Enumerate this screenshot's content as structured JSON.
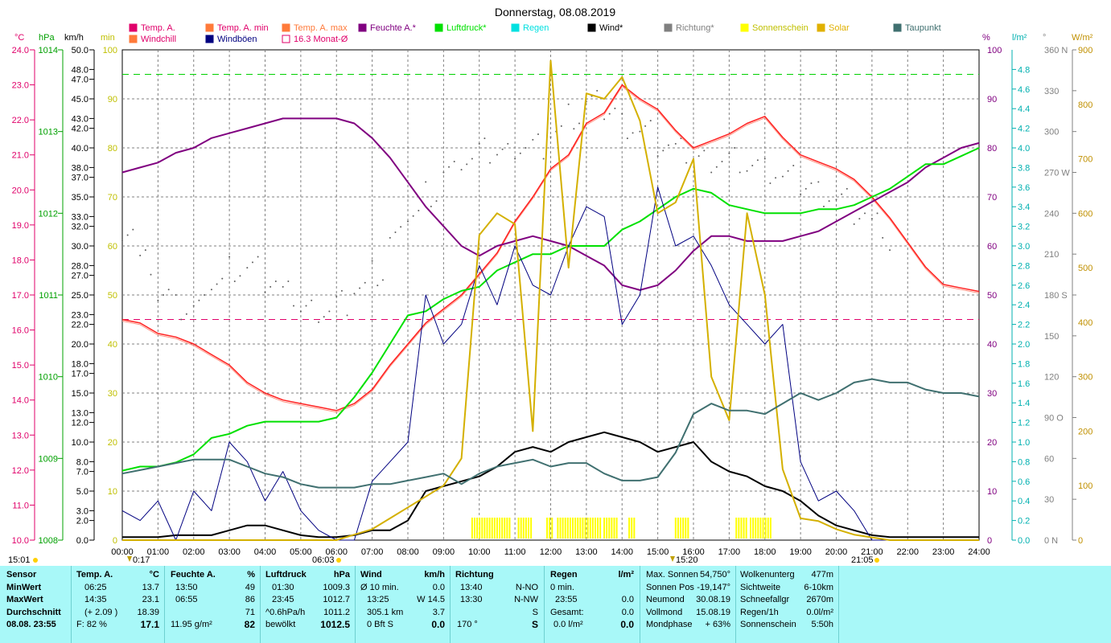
{
  "title": "Donnerstag, 08.08.2019",
  "legend": [
    {
      "label": "Temp. A.",
      "color": "#e0006a",
      "box": "fill"
    },
    {
      "label": "Temp. A. min",
      "color": "#ff7a3a",
      "box": "fill"
    },
    {
      "label": "Temp. A. max",
      "color": "#ff7a3a",
      "box": "fill"
    },
    {
      "label": "Feuchte A.*",
      "color": "#800080",
      "box": "fill"
    },
    {
      "label": "Luftdruck*",
      "color": "#00e000",
      "box": "fill"
    },
    {
      "label": "Regen",
      "color": "#00e0e0",
      "box": "fill"
    },
    {
      "label": "Wind*",
      "color": "#000000",
      "box": "fill"
    },
    {
      "label": "Richtung*",
      "color": "#808080",
      "box": "fill"
    },
    {
      "label": "Sonnenschein",
      "color": "#ffff00",
      "box": "fill"
    },
    {
      "label": "Solar",
      "color": "#e0b000",
      "box": "fill"
    },
    {
      "label": "Taupunkt",
      "color": "#407070",
      "box": "fill"
    },
    {
      "label": "Windchill",
      "color": "#ff7a3a",
      "box": "fill"
    },
    {
      "label": "Windböen",
      "color": "#000080",
      "box": "fill"
    },
    {
      "label": "16.3 Monat-Ø",
      "color": "#e0006a",
      "box": "outline"
    }
  ],
  "units": {
    "temp": "°C",
    "press": "hPa",
    "wind": "km/h",
    "sunmin": "min",
    "hum": "%",
    "rain": "l/m²",
    "dir": "°",
    "solar": "W/m²"
  },
  "axes": {
    "temp": [
      "24.0",
      "23.0",
      "22.0",
      "21.0",
      "20.0",
      "19.0",
      "18.0",
      "17.0",
      "16.0",
      "15.0",
      "14.0",
      "13.0",
      "12.0",
      "11.0",
      "10.0"
    ],
    "press": [
      "1014",
      "1013",
      "1012",
      "1011",
      "1010",
      "1009",
      "1008"
    ],
    "wind": [
      "50.0",
      "48.0",
      "47.0",
      "45.0",
      "43.0",
      "42.0",
      "40.0",
      "38.0",
      "37.0",
      "35.0",
      "33.0",
      "32.0",
      "30.0",
      "28.0",
      "27.0",
      "25.0",
      "23.0",
      "22.0",
      "20.0",
      "18.0",
      "17.0",
      "15.0",
      "13.0",
      "12.0",
      "10.0",
      "8.0",
      "7.0",
      "5.0",
      "3.0",
      "2.0",
      "0.0"
    ],
    "sunmin": [
      "100",
      "90",
      "80",
      "70",
      "60",
      "50",
      "40",
      "30",
      "20",
      "10",
      "0"
    ],
    "hum": [
      "100",
      "90",
      "80",
      "70",
      "60",
      "50",
      "40",
      "30",
      "20",
      "10",
      "0"
    ],
    "rain": [
      "4.8",
      "4.6",
      "4.4",
      "4.2",
      "4.0",
      "3.8",
      "3.6",
      "3.4",
      "3.2",
      "3.0",
      "2.8",
      "2.6",
      "2.4",
      "2.2",
      "2.0",
      "1.8",
      "1.6",
      "1.4",
      "1.2",
      "1.0",
      "0.8",
      "0.6",
      "0.4",
      "0.2",
      "0.0"
    ],
    "dir": [
      "360 N",
      "330",
      "300",
      "270 W",
      "240",
      "210",
      "180 S",
      "150",
      "120",
      "90 O",
      "60",
      "30",
      "0 N"
    ],
    "solar": [
      "900",
      "800",
      "700",
      "600",
      "500",
      "400",
      "300",
      "200",
      "100",
      "0"
    ],
    "time": [
      "00:00",
      "01:00",
      "02:00",
      "03:00",
      "04:00",
      "05:00",
      "06:00",
      "07:00",
      "08:00",
      "09:00",
      "10:00",
      "11:00",
      "12:00",
      "13:00",
      "14:00",
      "15:00",
      "16:00",
      "17:00",
      "18:00",
      "19:00",
      "20:00",
      "21:00",
      "22:00",
      "23:00",
      "24:00"
    ]
  },
  "markers": {
    "sunrise": "06:03",
    "sunset": "21:05",
    "moonrise": "15:01",
    "moonset": "0:17",
    "culmination": "15:20"
  },
  "chart_data": {
    "type": "line",
    "title": "Donnerstag, 08.08.2019",
    "x_hours": [
      0,
      0.5,
      1,
      1.5,
      2,
      2.5,
      3,
      3.5,
      4,
      4.5,
      5,
      5.5,
      6,
      6.5,
      7,
      7.5,
      8,
      8.5,
      9,
      9.5,
      10,
      10.5,
      11,
      11.5,
      12,
      12.5,
      13,
      13.5,
      14,
      14.5,
      15,
      15.5,
      16,
      16.5,
      17,
      17.5,
      18,
      18.5,
      19,
      19.5,
      20,
      20.5,
      21,
      21.5,
      22,
      22.5,
      23,
      23.5,
      24
    ],
    "ylim_temp": [
      10,
      24
    ],
    "ylim_press": [
      1008,
      1014
    ],
    "ylim_wind": [
      0,
      50
    ],
    "ylim_hum": [
      0,
      100
    ],
    "ylim_solar": [
      0,
      900
    ],
    "ylim_dir": [
      0,
      360
    ],
    "month_avg_temp": 16.3,
    "series": [
      {
        "name": "Temp. A.",
        "axis": "temp",
        "color": "#ff2020",
        "values": [
          16.3,
          16.2,
          15.9,
          15.8,
          15.6,
          15.3,
          15.0,
          14.5,
          14.2,
          14.0,
          13.9,
          13.8,
          13.7,
          13.9,
          14.3,
          15.0,
          15.6,
          16.2,
          16.6,
          17.0,
          17.6,
          18.2,
          19.1,
          19.8,
          20.6,
          21.0,
          21.9,
          22.2,
          23.0,
          22.6,
          22.3,
          21.7,
          21.2,
          21.4,
          21.6,
          21.9,
          22.1,
          21.5,
          21.0,
          20.8,
          20.6,
          20.3,
          19.8,
          19.2,
          18.5,
          17.8,
          17.3,
          17.2,
          17.1
        ]
      },
      {
        "name": "Feuchte A.*",
        "axis": "hum",
        "color": "#800080",
        "values": [
          75,
          76,
          77,
          79,
          80,
          82,
          83,
          84,
          85,
          86,
          86,
          86,
          86,
          85,
          82,
          78,
          73,
          68,
          64,
          60,
          58,
          60,
          61,
          62,
          61,
          60,
          58,
          56,
          52,
          51,
          52,
          55,
          59,
          62,
          62,
          61,
          61,
          61,
          62,
          63,
          65,
          67,
          69,
          71,
          73,
          76,
          78,
          80,
          81
        ]
      },
      {
        "name": "Luftdruck*",
        "axis": "press",
        "color": "#00e000",
        "values": [
          1008.85,
          1008.9,
          1008.9,
          1008.95,
          1009.05,
          1009.25,
          1009.3,
          1009.4,
          1009.45,
          1009.45,
          1009.45,
          1009.45,
          1009.5,
          1009.75,
          1010.05,
          1010.4,
          1010.75,
          1010.8,
          1010.95,
          1011.05,
          1011.1,
          1011.3,
          1011.4,
          1011.5,
          1011.5,
          1011.6,
          1011.6,
          1011.6,
          1011.8,
          1011.9,
          1012.05,
          1012.2,
          1012.3,
          1012.25,
          1012.1,
          1012.05,
          1012.0,
          1012.0,
          1012.0,
          1012.05,
          1012.05,
          1012.1,
          1012.2,
          1012.3,
          1012.45,
          1012.6,
          1012.6,
          1012.7,
          1012.8
        ]
      },
      {
        "name": "Wind*",
        "axis": "wind",
        "color": "#000000",
        "values": [
          0.3,
          0.3,
          0.3,
          0.5,
          0.5,
          0.5,
          1.0,
          1.5,
          1.5,
          1.0,
          0.5,
          0.3,
          0.3,
          0.5,
          1.0,
          1.0,
          2.0,
          5.0,
          5.5,
          6.0,
          6.5,
          7.5,
          9.0,
          9.5,
          9.0,
          10.0,
          10.5,
          11.0,
          10.5,
          10.0,
          9.0,
          9.5,
          10.0,
          8.0,
          7.0,
          6.5,
          5.5,
          5.0,
          4.0,
          2.5,
          1.5,
          1.0,
          0.5,
          0.3,
          0.3,
          0.3,
          0.3,
          0.3,
          0.3
        ]
      },
      {
        "name": "Windböen",
        "axis": "wind",
        "color": "#000080",
        "values": [
          3,
          2,
          4,
          0,
          5,
          3,
          10,
          8,
          4,
          7,
          3,
          1,
          0,
          0,
          6,
          8,
          10,
          25,
          20,
          22,
          28,
          24,
          30,
          26,
          25,
          30,
          34,
          33,
          22,
          25,
          36,
          30,
          31,
          28,
          24,
          22,
          20,
          22,
          8,
          4,
          5,
          3,
          0,
          0,
          0,
          0,
          0,
          0,
          0
        ]
      },
      {
        "name": "Richtung*",
        "axis": "dir",
        "color": "#808080",
        "values": [
          230,
          205,
          180,
          170,
          170,
          190,
          200,
          200,
          190,
          180,
          170,
          170,
          175,
          185,
          195,
          220,
          240,
          255,
          270,
          280,
          285,
          285,
          290,
          290,
          300,
          310,
          320,
          315,
          305,
          300,
          290,
          285,
          280,
          280,
          280,
          275,
          270,
          265,
          260,
          255,
          250,
          240,
          230,
          215,
          200,
          185,
          185,
          185,
          185
        ]
      },
      {
        "name": "Solar",
        "axis": "solar",
        "color": "#d4b000",
        "values": [
          0,
          0,
          0,
          0,
          0,
          0,
          0,
          0,
          0,
          0,
          0,
          0,
          0,
          10,
          20,
          40,
          60,
          80,
          100,
          150,
          560,
          600,
          580,
          200,
          880,
          500,
          820,
          810,
          850,
          770,
          600,
          620,
          700,
          300,
          220,
          600,
          450,
          130,
          40,
          35,
          20,
          10,
          5,
          0,
          0,
          0,
          0,
          0,
          0
        ]
      },
      {
        "name": "Taupunkt",
        "axis": "temp",
        "color": "#407070",
        "values": [
          11.9,
          12.0,
          12.1,
          12.2,
          12.3,
          12.3,
          12.3,
          12.1,
          11.9,
          11.8,
          11.6,
          11.5,
          11.5,
          11.5,
          11.6,
          11.6,
          11.7,
          11.8,
          11.9,
          11.6,
          11.9,
          12.1,
          12.2,
          12.3,
          12.1,
          12.2,
          12.2,
          11.9,
          11.7,
          11.7,
          11.8,
          12.5,
          13.6,
          13.9,
          13.7,
          13.7,
          13.6,
          13.9,
          14.2,
          14.0,
          14.2,
          14.5,
          14.6,
          14.5,
          14.5,
          14.3,
          14.2,
          14.2,
          14.1
        ]
      }
    ],
    "sunshine_hours": [
      [
        9.8,
        10.9
      ],
      [
        11.1,
        11.5
      ],
      [
        11.9,
        12.1
      ],
      [
        12.2,
        13.4
      ],
      [
        13.5,
        13.9
      ],
      [
        14.2,
        14.4
      ],
      [
        15.5,
        15.9
      ],
      [
        17.2,
        17.5
      ],
      [
        17.6,
        18.2
      ]
    ],
    "gust_minutes": {
      "visible": true
    }
  },
  "panel": {
    "sensor": {
      "head": "Sensor",
      "rows": [
        "MinWert",
        "MaxWert",
        "Durchschnitt",
        "08.08. 23:55"
      ]
    },
    "temp": {
      "head": "Temp. A.",
      "unit": "°C",
      "r1a": "06:25",
      "r1b": "13.7",
      "r2a": "14:35",
      "r2b": "23.1",
      "r3a": "(+ 2.09 )",
      "r3b": "18.39",
      "r4a": "F: 82 %",
      "r4b": "17.1"
    },
    "hum": {
      "head": "Feuchte A.",
      "unit": "%",
      "r1a": "13:50",
      "r1b": "49",
      "r2a": "06:55",
      "r2b": "86",
      "r3a": "",
      "r3b": "71",
      "r4a": "11.95 g/m²",
      "r4b": "82"
    },
    "press": {
      "head": "Luftdruck",
      "unit": "hPa",
      "r1a": "01:30",
      "r1b": "1009.3",
      "r2a": "23:45",
      "r2b": "1012.7",
      "r3a": "^0.6hPa/h",
      "r3b": "1011.2",
      "r4a": "bewölkt",
      "r4b": "1012.5"
    },
    "wind": {
      "head": "Wind",
      "unit": "km/h",
      "r1a": "Ø 10 min.",
      "r1b": "0.0",
      "r2a": "13:25",
      "r2b": "W 14.5",
      "r3a": "305.1 km",
      "r3b": "3.7",
      "r4a": "0 Bft S",
      "r4b": "0.0"
    },
    "dir": {
      "head": "Richtung",
      "r1a": "13:40",
      "r1b": "N-NO",
      "r2a": "13:30",
      "r2b": "N-NW",
      "r3a": "",
      "r3b": "S",
      "r4a": "170 °",
      "r4b": "S"
    },
    "rain": {
      "head": "Regen",
      "unit": "l/m²",
      "r1a": "0 min.",
      "r1b": "",
      "r2a": "23:55",
      "r2b": "0.0",
      "r3a": "Gesamt:",
      "r3b": "0.0",
      "r4a": "0.0 l/m²",
      "r4b": "0.0"
    },
    "astro": {
      "r1a": "Max. Sonnen",
      "r1b": "54,750°",
      "r2a": "Sonnen Pos",
      "r2b": "-19,147°",
      "r3a": "Neumond",
      "r3b": "30.08.19",
      "r4a": "Vollmond",
      "r4b": "15.08.19",
      "r5a": "Mondphase",
      "r5b": "+ 63%"
    },
    "misc": {
      "r1a": "Wolkenunterg",
      "r1b": "477m",
      "r2a": "Sichtweite",
      "r2b": "6-10km",
      "r3a": "Schneefallgr",
      "r3b": "2670m",
      "r4a": "Regen/1h",
      "r4b": "0.0l/m²",
      "r5a": "Sonnenschein",
      "r5b": "5:50h"
    }
  }
}
